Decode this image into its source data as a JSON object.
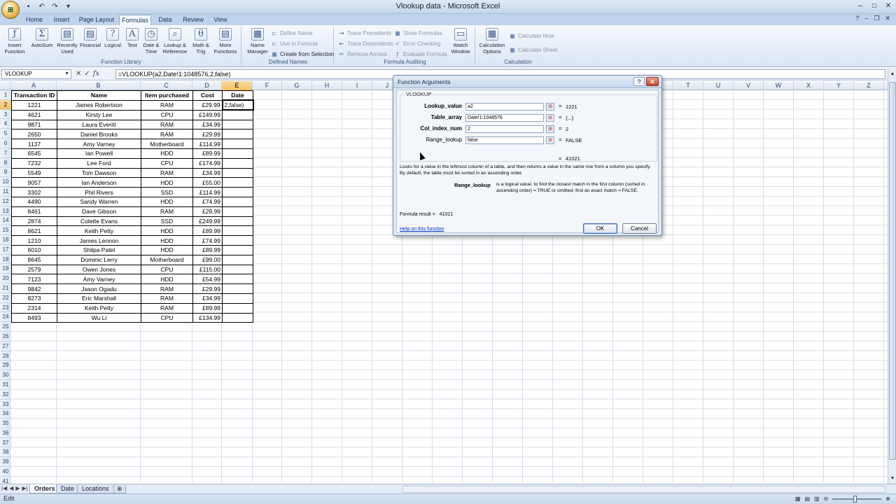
{
  "window": {
    "title": "Vlookup data - Microsoft Excel"
  },
  "ribbon": {
    "tabs": [
      "Home",
      "Insert",
      "Page Layout",
      "Formulas",
      "Data",
      "Review",
      "View"
    ],
    "active_tab": "Formulas",
    "function_library": {
      "label": "Function Library",
      "insert_function": "Insert Function",
      "autosum": "AutoSum",
      "recently_used": "Recently Used",
      "financial": "Financial",
      "logical": "Logical",
      "text": "Text",
      "date_time": "Date & Time",
      "lookup_reference": "Lookup & Reference",
      "math_trig": "Math & Trig",
      "more_functions": "More Functions"
    },
    "defined_names": {
      "label": "Defined Names",
      "name_manager": "Name Manager",
      "define_name": "Define Name",
      "use_in_formula": "Use in Formula",
      "create_from_selection": "Create from Selection"
    },
    "formula_auditing": {
      "label": "Formula Auditing",
      "trace_precedents": "Trace Precedents",
      "trace_dependents": "Trace Dependents",
      "remove_arrows": "Remove Arrows",
      "show_formulas": "Show Formulas",
      "error_checking": "Error Checking",
      "evaluate_formula": "Evaluate Formula",
      "watch_window": "Watch Window"
    },
    "calculation": {
      "label": "Calculation",
      "calculation_options": "Calculation Options",
      "calculate_now": "Calculate Now",
      "calculate_sheet": "Calculate Sheet"
    }
  },
  "formula_bar": {
    "name_box": "VLOOKUP",
    "formula": "=VLOOKUP(a2,Date!1:1048576,2,false)"
  },
  "columns": [
    "A",
    "B",
    "C",
    "D",
    "E",
    "F",
    "G",
    "H",
    "I",
    "J",
    "K",
    "L",
    "M",
    "N",
    "O",
    "P",
    "Q",
    "R",
    "S",
    "T",
    "U",
    "V",
    "W",
    "X",
    "Y",
    "Z"
  ],
  "rows": [
    "1",
    "2",
    "3",
    "4",
    "5",
    "6",
    "7",
    "8",
    "9",
    "10",
    "11",
    "12",
    "13",
    "14",
    "15",
    "16",
    "17",
    "18",
    "19",
    "20",
    "21",
    "22",
    "23",
    "24",
    "25",
    "26",
    "27",
    "28",
    "29",
    "30",
    "31",
    "32",
    "33",
    "34",
    "35",
    "36",
    "37",
    "38",
    "39",
    "40",
    "41"
  ],
  "table": {
    "headers": [
      "Transaction ID",
      "Name",
      "Item purchased",
      "Cost",
      "Date"
    ],
    "rows": [
      [
        "1221",
        "James Robertson",
        "RAM",
        "£29.99",
        "2,false)"
      ],
      [
        "4621",
        "Kirsty Lee",
        "CPU",
        "£149.99",
        ""
      ],
      [
        "9871",
        "Laura Everitt",
        "RAM",
        "£34.99",
        ""
      ],
      [
        "2650",
        "Daniel Brooks",
        "RAM",
        "£29.99",
        ""
      ],
      [
        "1137",
        "Amy Varney",
        "Motherboard",
        "£114.99",
        ""
      ],
      [
        "6545",
        "Ian Powell",
        "HDD",
        "£89.99",
        ""
      ],
      [
        "7232",
        "Lee Ford",
        "CPU",
        "£174.99",
        ""
      ],
      [
        "5549",
        "Tom Dawson",
        "RAM",
        "£34.99",
        ""
      ],
      [
        "9057",
        "Ian Anderson",
        "HDD",
        "£55.00",
        ""
      ],
      [
        "3302",
        "Phil Rivers",
        "SSD",
        "£114.99",
        ""
      ],
      [
        "4490",
        "Sandy Warren",
        "HDD",
        "£74.99",
        ""
      ],
      [
        "8461",
        "Dave Gibson",
        "RAM",
        "£28.99",
        ""
      ],
      [
        "2874",
        "Colette Evans",
        "SSD",
        "£249.99",
        ""
      ],
      [
        "8621",
        "Keith Petty",
        "HDD",
        "£89.99",
        ""
      ],
      [
        "1210",
        "James Lennon",
        "HDD",
        "£74.99",
        ""
      ],
      [
        "6010",
        "Shilpa Patel",
        "HDD",
        "£89.99",
        ""
      ],
      [
        "8645",
        "Dominic Lerry",
        "Motherboard",
        "£99.00",
        ""
      ],
      [
        "2579",
        "Owen Jones",
        "CPU",
        "£115.00",
        ""
      ],
      [
        "7123",
        "Amy Varney",
        "HDD",
        "£54.99",
        ""
      ],
      [
        "9842",
        "Jason Ogadu",
        "RAM",
        "£29.99",
        ""
      ],
      [
        "8273",
        "Eric Marshall",
        "RAM",
        "£34.99",
        ""
      ],
      [
        "2314",
        "Keith Petty",
        "RAM",
        "£89.99",
        ""
      ],
      [
        "8493",
        "Wu Li",
        "CPU",
        "£134.99",
        ""
      ]
    ]
  },
  "sheets": [
    "Orders",
    "Date",
    "Locations"
  ],
  "active_sheet": "Orders",
  "status": {
    "mode": "Edit"
  },
  "dialog": {
    "title": "Function Arguments",
    "function_name": "VLOOKUP",
    "args": [
      {
        "label": "Lookup_value",
        "value": "a2",
        "result": "1221",
        "bold": true
      },
      {
        "label": "Table_array",
        "value": "Date!1:1048576",
        "result": "{...}",
        "bold": true
      },
      {
        "label": "Col_index_num",
        "value": "2",
        "result": "2",
        "bold": true
      },
      {
        "label": "Range_lookup",
        "value": "false",
        "result": "FALSE",
        "bold": false
      }
    ],
    "function_result": "41021",
    "description": "Looks for a value in the leftmost column of a table, and then returns a value in the same row from a column you specify. By default, the table must be sorted in an ascending order.",
    "arg_desc_name": "Range_lookup",
    "arg_desc_text": "is a logical value: to find the closest match in the first column (sorted in ascending order) = TRUE or omitted; find an exact match = FALSE.",
    "formula_result_label": "Formula result =",
    "formula_result_value": "41021",
    "help_link": "Help on this function",
    "ok": "OK",
    "cancel": "Cancel"
  }
}
